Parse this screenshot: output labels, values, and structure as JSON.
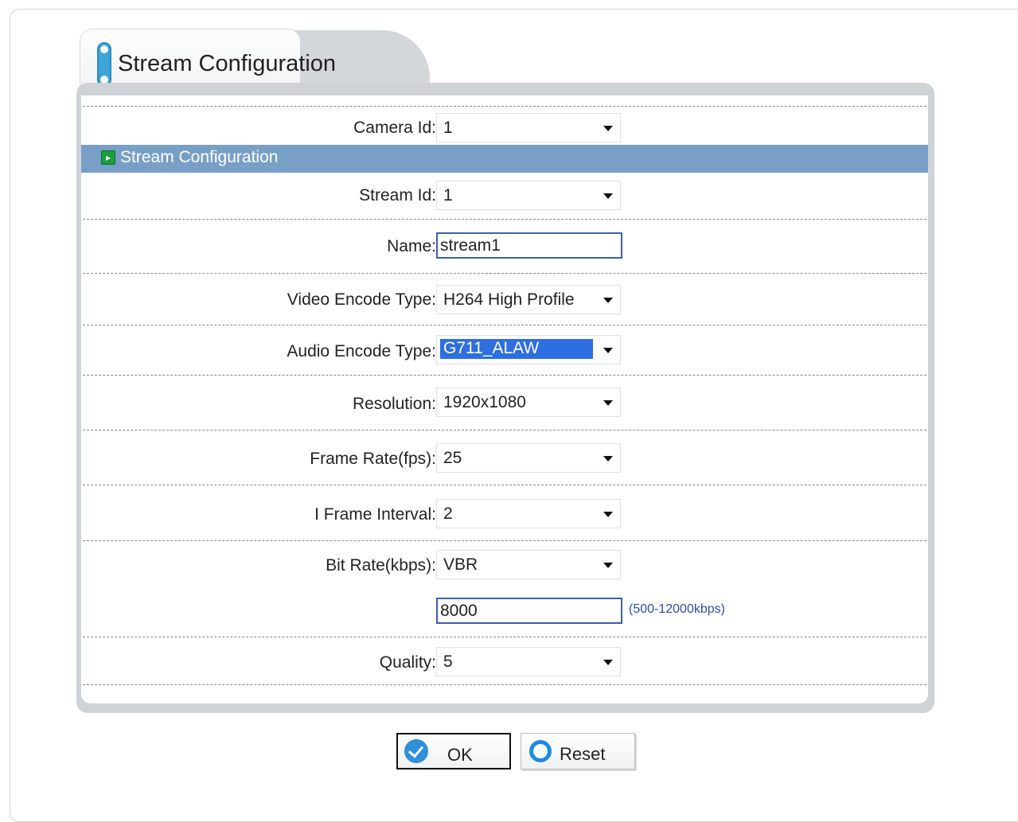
{
  "tab": {
    "title": "Stream Configuration"
  },
  "section": {
    "title": "Stream Configuration"
  },
  "fields": {
    "camera_id": {
      "label": "Camera Id:",
      "value": "1"
    },
    "stream_id": {
      "label": "Stream Id:",
      "value": "1"
    },
    "name": {
      "label": "Name:",
      "value": "stream1"
    },
    "video_encode_type": {
      "label": "Video Encode Type:",
      "value": "H264 High Profile"
    },
    "audio_encode_type": {
      "label": "Audio Encode Type:",
      "value": "G711_ALAW"
    },
    "resolution": {
      "label": "Resolution:",
      "value": "1920x1080"
    },
    "frame_rate": {
      "label": "Frame Rate(fps):",
      "value": "25"
    },
    "i_frame_interval": {
      "label": "I Frame Interval:",
      "value": "2"
    },
    "bit_rate": {
      "label": "Bit Rate(kbps):",
      "value": "VBR"
    },
    "bit_rate_value": {
      "value": "8000",
      "hint": "(500-12000kbps)"
    },
    "quality": {
      "label": "Quality:",
      "value": "5"
    }
  },
  "buttons": {
    "ok": "OK",
    "reset": "Reset"
  },
  "icons": {
    "section": "play-icon",
    "ok": "check-icon",
    "reset": "reset-icon"
  },
  "colors": {
    "section_bar": "#789fc6",
    "highlight": "#2d6ee0",
    "accent": "#3ea6d6"
  }
}
